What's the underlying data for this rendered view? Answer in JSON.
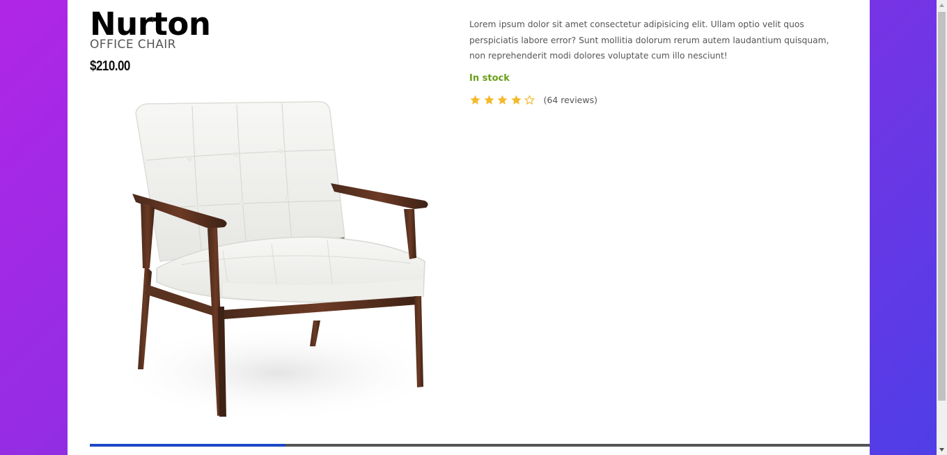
{
  "product": {
    "name": "Nurton",
    "category": "OFFICE CHAIR",
    "price": "$210.00",
    "description": "Lorem ipsum dolor sit amet consectetur adipisicing elit. Ullam optio velit quos perspiciatis labore error? Sunt mollitia dolorum rerum autem laudantium quisquam, non reprehenderit modi dolores voluptate cum illo nesciunt!",
    "stock_status": "In stock",
    "rating": {
      "value": 4,
      "max": 5,
      "reviews_label": "(64 reviews)"
    },
    "image_alt": "white tufted chair with dark wood frame"
  },
  "colors": {
    "background_gradient_start": "#b026e6",
    "background_gradient_end": "#4e3ee6",
    "stock": "#6a9e1a",
    "star": "#f5b92a",
    "tab_active": "#1b48c7",
    "tab_track": "#555555"
  },
  "tabs": {
    "active_index": 0
  },
  "icons": {
    "star_filled": "star-filled-icon",
    "star_empty": "star-outline-icon"
  }
}
